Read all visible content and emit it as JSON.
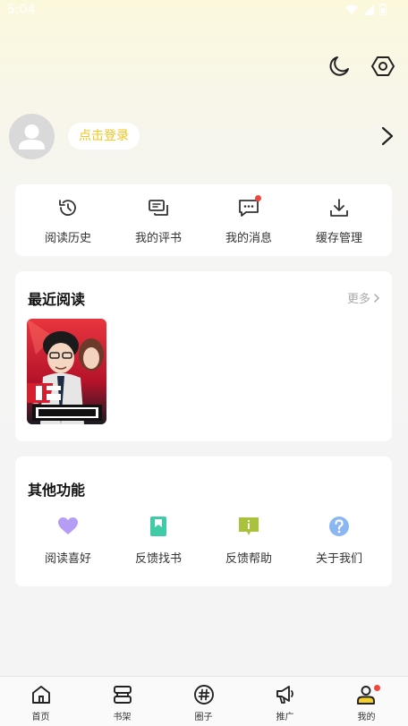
{
  "status_bar": {
    "time": "5:04"
  },
  "top_icons": [
    "moon-icon",
    "settings-hexagon-icon"
  ],
  "profile": {
    "login_label": "点击登录"
  },
  "quick_actions": [
    {
      "label": "阅读历史",
      "icon": "history-icon"
    },
    {
      "label": "我的评书",
      "icon": "comments-icon"
    },
    {
      "label": "我的消息",
      "icon": "message-icon",
      "badge": true
    },
    {
      "label": "缓存管理",
      "icon": "download-icon"
    }
  ],
  "recent": {
    "title": "最近阅读",
    "more_label": "更多"
  },
  "other": {
    "title": "其他功能",
    "items": [
      {
        "label": "阅读喜好",
        "icon": "heart-icon",
        "color": "#b59cf5"
      },
      {
        "label": "反馈找书",
        "icon": "bookmark-book-icon",
        "color": "#3fcba8"
      },
      {
        "label": "反馈帮助",
        "icon": "info-board-icon",
        "color": "#a9c23c"
      },
      {
        "label": "关于我们",
        "icon": "question-icon",
        "color": "#8ab6f3"
      }
    ]
  },
  "tabs": [
    {
      "label": "首页",
      "icon": "home-icon"
    },
    {
      "label": "书架",
      "icon": "shelf-icon"
    },
    {
      "label": "圈子",
      "icon": "hashtag-icon"
    },
    {
      "label": "推广",
      "icon": "megaphone-icon"
    },
    {
      "label": "我的",
      "icon": "user-icon",
      "badge": true
    }
  ],
  "colors": {
    "accent": "#f3c51a",
    "badge": "#f0453a"
  }
}
